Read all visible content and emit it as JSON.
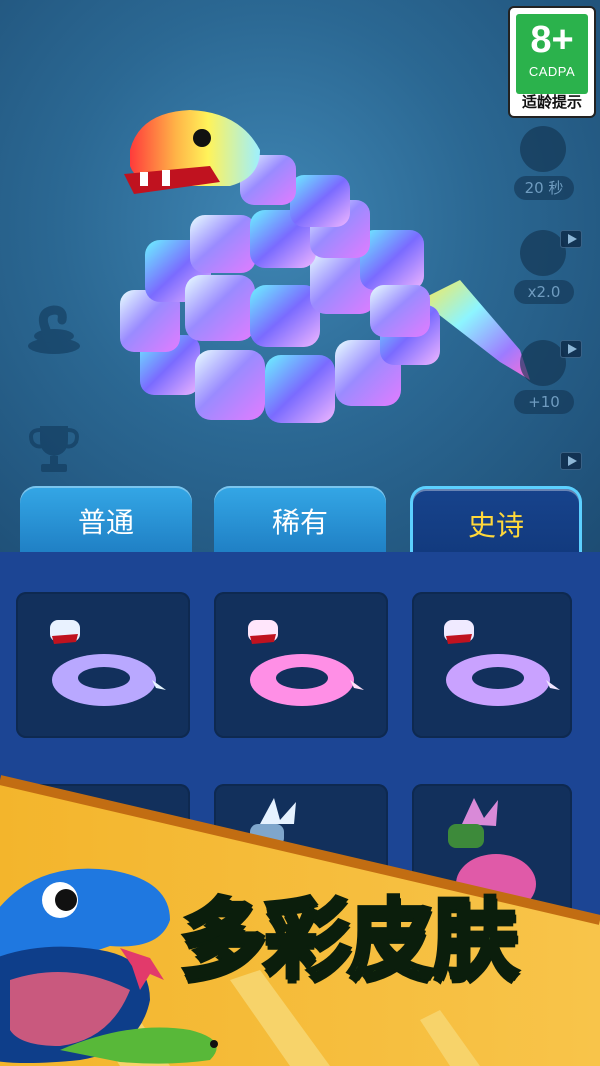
{
  "age_rating": {
    "number": "8+",
    "org": "CADPA",
    "label": "适龄提示"
  },
  "boosters": [
    {
      "icon": "magnet-icon",
      "value": "20 秒"
    },
    {
      "icon": "speedometer-icon",
      "value": "x2.0"
    },
    {
      "icon": "level-up-icon",
      "value": "+10"
    }
  ],
  "left_icons": [
    "snake-coil-icon",
    "trophy-icon"
  ],
  "tabs": [
    {
      "label": "普通",
      "active": false
    },
    {
      "label": "稀有",
      "active": false
    },
    {
      "label": "史诗",
      "active": true
    }
  ],
  "skins": [
    {
      "name": "lavender-coil-skin",
      "color": "#b9a8ff"
    },
    {
      "name": "pink-coil-skin",
      "color": "#ff8fe6"
    },
    {
      "name": "violet-coil-skin",
      "color": "#c9a2ff"
    },
    {
      "name": "hidden-skin",
      "color": "#12305c"
    },
    {
      "name": "ice-dragon-skin",
      "color": "#9fc4e8"
    },
    {
      "name": "magma-dragon-skin",
      "color": "#e05aa8"
    }
  ],
  "promo": {
    "text": "多彩皮肤"
  },
  "colors": {
    "tab_active_text": "#ffd83a",
    "tab_active_border": "#5cd0ff",
    "panel_bg": "#1c4594",
    "card_bg": "#12305c",
    "promo_text": "#8fe03a"
  }
}
